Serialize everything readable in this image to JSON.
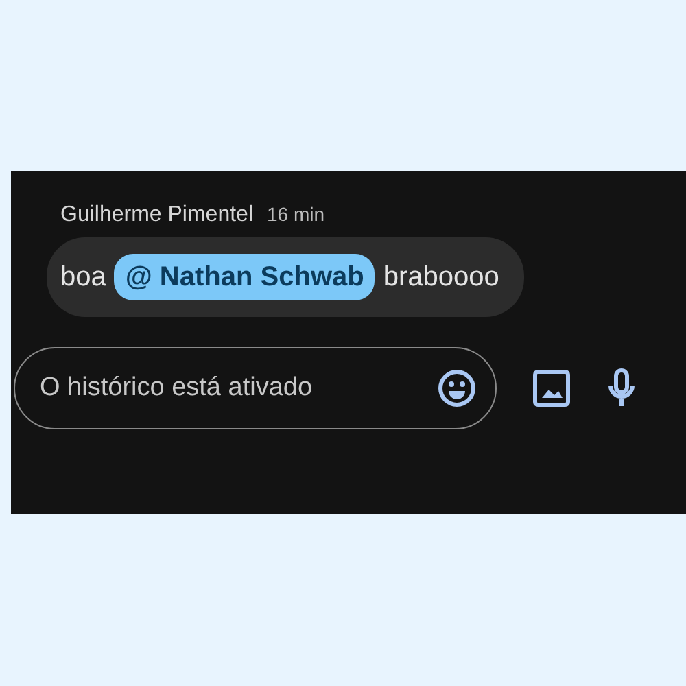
{
  "message": {
    "sender": "Guilherme Pimentel",
    "time": "16 min",
    "parts": [
      {
        "kind": "text",
        "text": "boa"
      },
      {
        "kind": "mention",
        "text": "@ Nathan Schwab"
      },
      {
        "kind": "text",
        "text": "braboooo"
      }
    ]
  },
  "composer": {
    "placeholder": "O histórico está ativado"
  }
}
